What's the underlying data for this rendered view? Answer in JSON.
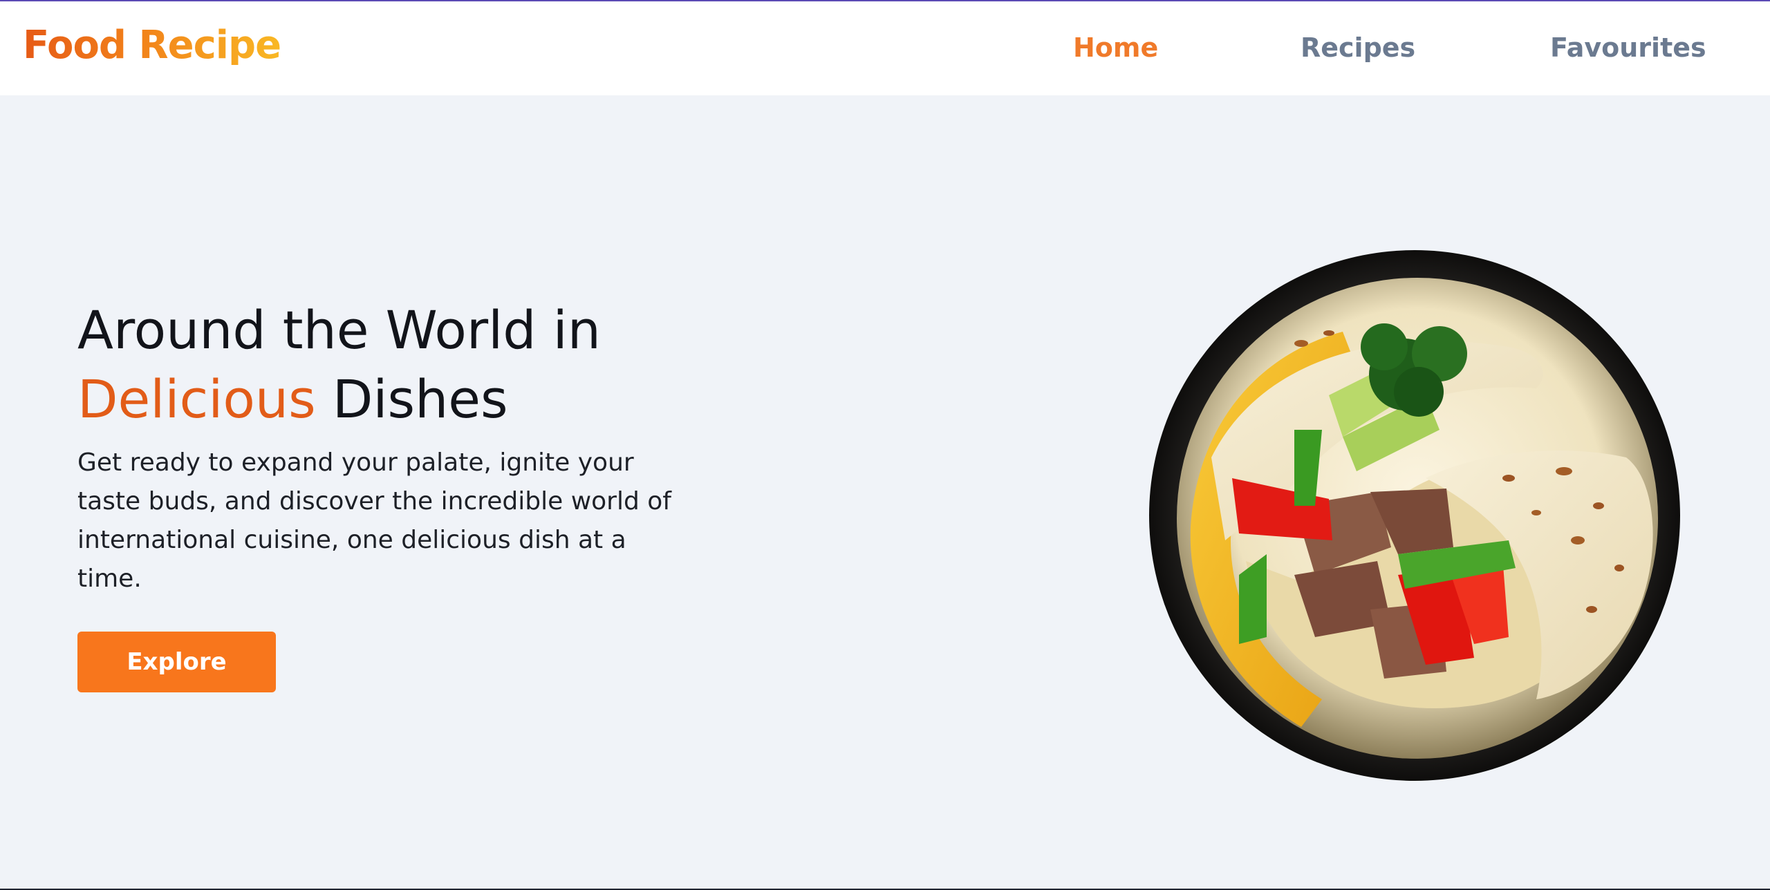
{
  "brand": {
    "name": "Food Recipe"
  },
  "nav": {
    "items": [
      {
        "label": "Home",
        "active": true
      },
      {
        "label": "Recipes",
        "active": false
      },
      {
        "label": "Favourites",
        "active": false
      }
    ]
  },
  "hero": {
    "title_line1": "Around the World in",
    "title_accent": "Delicious",
    "title_rest": "Dishes",
    "description": "Get ready to expand your palate, ignite your taste buds, and discover the incredible world of international cuisine, one delicious dish at a time.",
    "cta_label": "Explore"
  },
  "colors": {
    "accent": "#f8761c",
    "accent_text": "#e25c18",
    "nav_inactive": "#6b7a90",
    "page_bg": "#f0f3f8"
  },
  "icons": {
    "hero_image": "wrap-dish-illustration"
  }
}
